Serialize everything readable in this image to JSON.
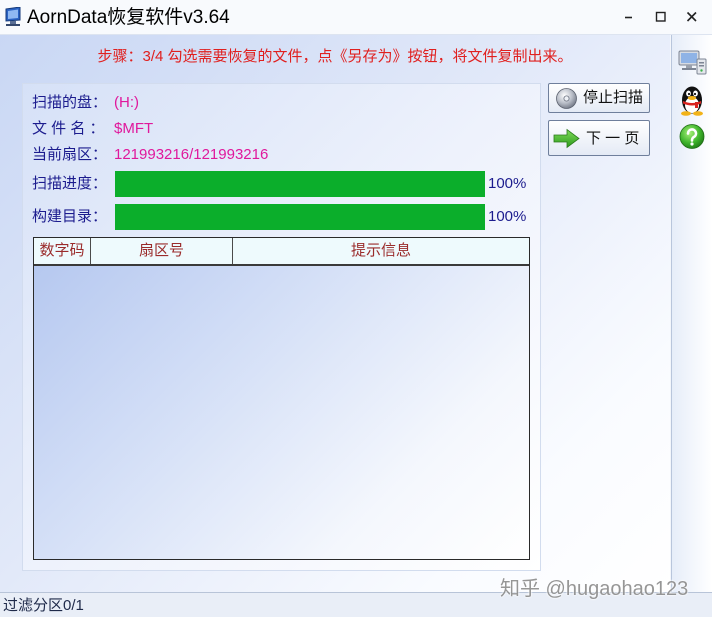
{
  "window": {
    "title": "AornData恢复软件v3.64",
    "app_icon": "app-monitor-icon",
    "controls": [
      "minimize-icon",
      "maximize-icon",
      "close-icon"
    ]
  },
  "instruction": "步骤：3/4 勾选需要恢复的文件，点《另存为》按钮，将文件复制出来。",
  "info": {
    "disk": {
      "label": "扫描的盘：",
      "value": "(H:)"
    },
    "file": {
      "label": "文 件 名 ：",
      "value": "$MFT"
    },
    "sector": {
      "label": "当前扇区：",
      "value": "121993216/121993216"
    }
  },
  "progress": [
    {
      "label": "扫描进度：",
      "value": 1.0,
      "text": "100%"
    },
    {
      "label": "构建目录：",
      "value": 1.0,
      "text": "100%"
    }
  ],
  "table": {
    "columns": [
      "数字码",
      "扇区号",
      "提示信息"
    ],
    "rows": []
  },
  "buttons": {
    "stop_scan": {
      "label": "停止扫描",
      "icon": "disc-icon"
    },
    "next_page": {
      "label": "下 一 页",
      "icon": "green-arrow-right-icon"
    }
  },
  "sidebar": {
    "icons": [
      "network-computer-icon",
      "qq-penguin-icon",
      "help-question-icon"
    ]
  },
  "status_bar": {
    "text": "过滤分区0/1"
  },
  "watermark": "知乎 @hugaohao123",
  "colors": {
    "label": "#1c1c8e",
    "value": "#e0189c",
    "instruction": "#e0201f",
    "table_header_text": "#9a2b2b",
    "progress_fill": "#0bae2b"
  }
}
